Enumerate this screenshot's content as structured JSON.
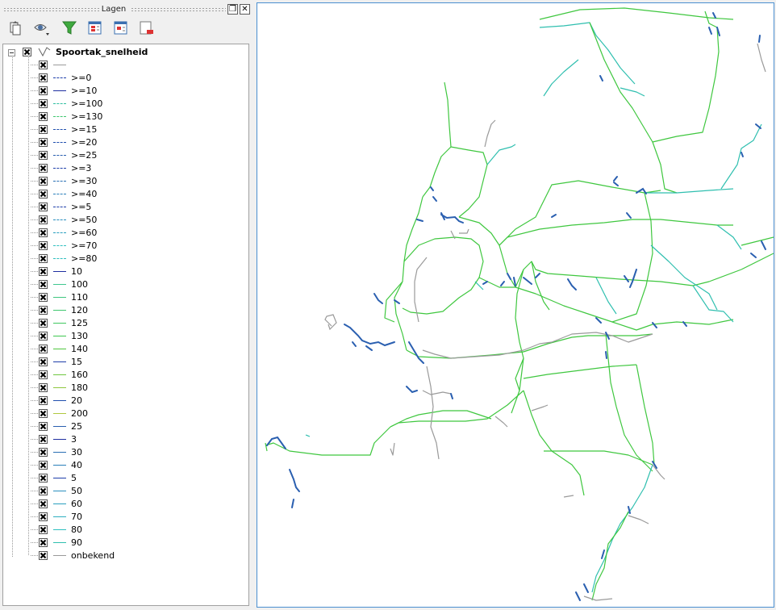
{
  "dock": {
    "title": "Lagen",
    "float_glyph": "❐",
    "close_glyph": "✕"
  },
  "toolbar": {
    "buttons": [
      {
        "name": "add-group-icon"
      },
      {
        "name": "visibility-eye-icon"
      },
      {
        "name": "filter-legend-icon"
      },
      {
        "name": "expand-all-icon"
      },
      {
        "name": "collapse-all-icon"
      },
      {
        "name": "remove-layer-icon"
      }
    ]
  },
  "layer": {
    "name": "Spoortak_snelheid",
    "checked": true,
    "expanded": true
  },
  "legend": [
    {
      "label": "",
      "color": "#9a9a9a",
      "style": "solid"
    },
    {
      "label": ">=0",
      "color": "#1f3faa",
      "style": "dashed"
    },
    {
      "label": ">=10",
      "color": "#1f2fa0",
      "style": "solid"
    },
    {
      "label": ">=100",
      "color": "#2fbfa0",
      "style": "dashed"
    },
    {
      "label": ">=130",
      "color": "#3fc76f",
      "style": "dashed"
    },
    {
      "label": ">=15",
      "color": "#1f4fae",
      "style": "dashed"
    },
    {
      "label": ">=20",
      "color": "#1f4fae",
      "style": "dashed"
    },
    {
      "label": ">=25",
      "color": "#2a5fb0",
      "style": "dashed"
    },
    {
      "label": ">=3",
      "color": "#1f3faa",
      "style": "dashed"
    },
    {
      "label": ">=30",
      "color": "#2a6fb4",
      "style": "dashed"
    },
    {
      "label": ">=40",
      "color": "#2a7fba",
      "style": "dashed"
    },
    {
      "label": ">=5",
      "color": "#1f3faa",
      "style": "dashed"
    },
    {
      "label": ">=50",
      "color": "#2a8fbf",
      "style": "dashed"
    },
    {
      "label": ">=60",
      "color": "#2a9fbf",
      "style": "dashed"
    },
    {
      "label": ">=70",
      "color": "#2fbfbf",
      "style": "dashed"
    },
    {
      "label": ">=80",
      "color": "#2fbfbf",
      "style": "dashed"
    },
    {
      "label": "10",
      "color": "#1f2fa0",
      "style": "solid"
    },
    {
      "label": "100",
      "color": "#3fc78f",
      "style": "solid"
    },
    {
      "label": "110",
      "color": "#3fc77f",
      "style": "solid"
    },
    {
      "label": "120",
      "color": "#3fc76f",
      "style": "solid"
    },
    {
      "label": "125",
      "color": "#3fc75f",
      "style": "solid"
    },
    {
      "label": "130",
      "color": "#3fc74f",
      "style": "solid"
    },
    {
      "label": "140",
      "color": "#4fc73f",
      "style": "solid"
    },
    {
      "label": "15",
      "color": "#1f3faa",
      "style": "solid"
    },
    {
      "label": "160",
      "color": "#6fc73f",
      "style": "solid"
    },
    {
      "label": "180",
      "color": "#8fc73f",
      "style": "solid"
    },
    {
      "label": "20",
      "color": "#1f4fae",
      "style": "solid"
    },
    {
      "label": "200",
      "color": "#b0c73f",
      "style": "solid"
    },
    {
      "label": "25",
      "color": "#2a5fb0",
      "style": "solid"
    },
    {
      "label": "3",
      "color": "#1f2fa0",
      "style": "solid"
    },
    {
      "label": "30",
      "color": "#2a6fb4",
      "style": "solid"
    },
    {
      "label": "40",
      "color": "#2a7fba",
      "style": "solid"
    },
    {
      "label": "5",
      "color": "#1f3faa",
      "style": "solid"
    },
    {
      "label": "50",
      "color": "#2a8fbf",
      "style": "solid"
    },
    {
      "label": "60",
      "color": "#2a9fbf",
      "style": "solid"
    },
    {
      "label": "70",
      "color": "#2fafbf",
      "style": "solid"
    },
    {
      "label": "80",
      "color": "#2fbfbf",
      "style": "solid"
    },
    {
      "label": "90",
      "color": "#2fbfaf",
      "style": "solid"
    },
    {
      "label": "onbekend",
      "color": "#9a9a9a",
      "style": "solid"
    }
  ],
  "map": {
    "background": "#ffffff",
    "colors": {
      "green": "#3fc73f",
      "teal": "#2fbfaf",
      "blue": "#2a5fb0",
      "grey": "#9a9a9a"
    }
  }
}
